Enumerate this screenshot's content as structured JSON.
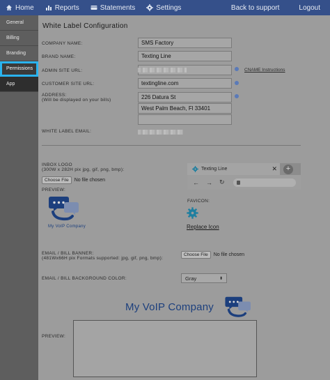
{
  "nav": {
    "home": "Home",
    "reports": "Reports",
    "statements": "Statements",
    "settings": "Settings",
    "back": "Back to support",
    "logout": "Logout"
  },
  "sidebar": {
    "items": [
      {
        "label": "General"
      },
      {
        "label": "Billing"
      },
      {
        "label": "Branding"
      },
      {
        "label": "Permissions"
      },
      {
        "label": "App"
      }
    ]
  },
  "form": {
    "title": "White Label Configuration",
    "company_label": "COMPANY NAME:",
    "company_value": "SMS Factory",
    "brand_label": "BRAND NAME:",
    "brand_value": "Texting Line",
    "admin_label": "ADMIN SITE URL:",
    "cname_link": "CNAME Instructions",
    "customer_label": "CUSTOMER SITE URL:",
    "customer_value": "textingline.com",
    "address_label": "ADDRESS:",
    "address_sub": "(Will be displayed on your bills)",
    "address_line1": "226 Datura St",
    "address_line2": "West Palm Beach, Fl 33401",
    "address_line3": "",
    "email_label": "WHITE LABEL EMAIL:"
  },
  "inbox": {
    "label": "INBOX LOGO",
    "sub": "(300W x 282H pix jpg, gif, png, bmp):",
    "choose_btn": "Choose File",
    "no_file": "No file chosen",
    "preview_label": "PREVIEW:",
    "logo_caption": "My VoIP Company",
    "tab_title": "Texting Line",
    "tab_close": "✕",
    "tab_plus": "+",
    "nav_back": "←",
    "nav_forward": "→",
    "nav_reload": "↻",
    "favicon_label": "FAVICON:",
    "replace_icon": "Replace Icon"
  },
  "banner": {
    "label": "EMAIL / BILL BANNER:",
    "sub": "(481Wx66H pix Formats supported: jpg, gif, png, bmp):",
    "choose_btn": "Choose File",
    "no_file": "No file chosen",
    "bg_label": "EMAIL / BILL BACKGROUND COLOR:",
    "bg_value": "Gray",
    "banner_text": "My VoIP Company",
    "preview_label": "PREVIEW:"
  },
  "colors": {
    "nav_bg": "#35508a",
    "accent_highlight": "#2ab3ee",
    "logo_blue": "#1c3f7d"
  }
}
